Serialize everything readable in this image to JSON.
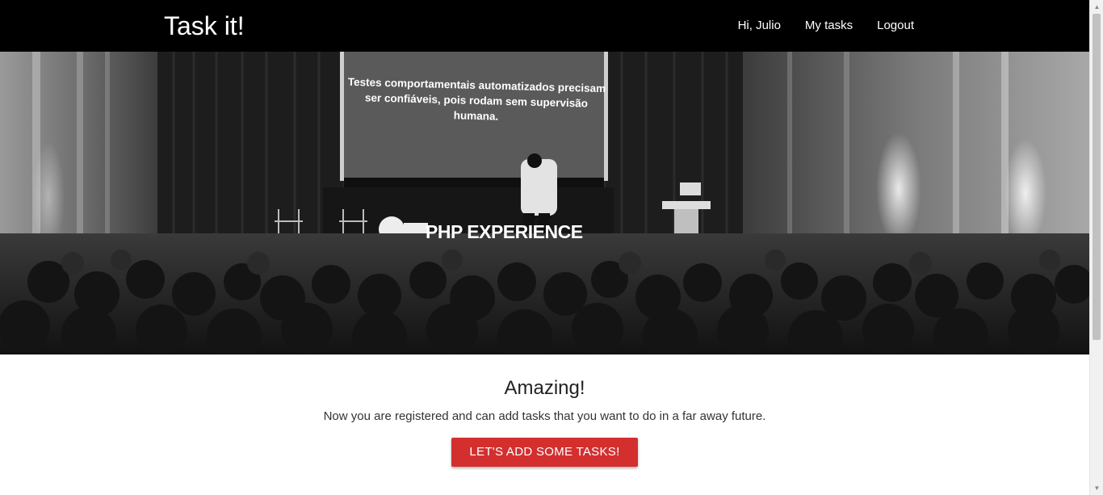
{
  "navbar": {
    "brand": "Task it!",
    "links": [
      "Hi, Julio",
      "My tasks",
      "Logout"
    ]
  },
  "hero": {
    "slide_text": "Testes comportamentais automatizados precisam ser confiáveis, pois rodam sem supervisão humana.",
    "sponsor_text": "PHP EXPERIENCE"
  },
  "content": {
    "headline": "Amazing!",
    "subtext": "Now you are registered and can add tasks that you want to do in a far away future.",
    "cta_label": "LET'S ADD SOME TASKS!"
  },
  "colors": {
    "navbar_bg": "#000000",
    "cta_bg": "#d32f2f"
  },
  "icons": {
    "scroll_up": "▲",
    "scroll_down": "▼"
  }
}
